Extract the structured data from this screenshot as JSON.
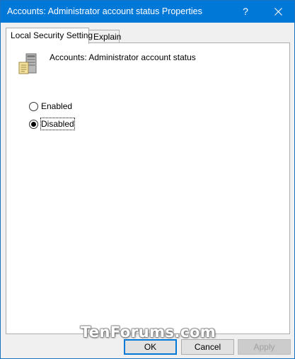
{
  "window": {
    "title": "Accounts: Administrator account status Properties",
    "help_label": "?"
  },
  "tabs": [
    {
      "label": "Local Security Setting",
      "active": true
    },
    {
      "label": "Explain",
      "active": false
    }
  ],
  "policy": {
    "name": "Accounts: Administrator account status",
    "icon": "server-computer-icon"
  },
  "options": [
    {
      "label": "Enabled",
      "checked": false
    },
    {
      "label": "Disabled",
      "checked": true
    }
  ],
  "watermark": "TenForums.com",
  "buttons": {
    "ok": "OK",
    "cancel": "Cancel",
    "apply": "Apply"
  },
  "colors": {
    "titlebar": "#0078d7",
    "accent": "#0078d7"
  }
}
